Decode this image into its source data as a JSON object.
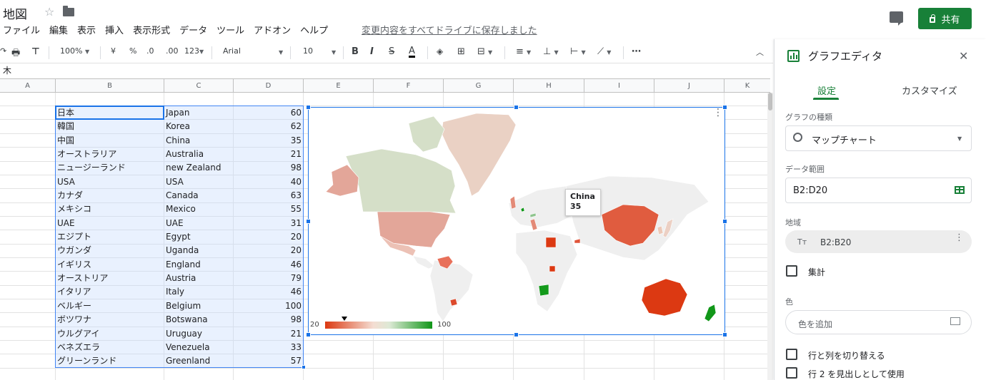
{
  "doc": {
    "title": "地図"
  },
  "menu": [
    "ファイル",
    "編集",
    "表示",
    "挿入",
    "表示形式",
    "データ",
    "ツール",
    "アドオン",
    "ヘルプ"
  ],
  "save_status": "変更内容をすべてドライブに保存しました",
  "share_label": "共有",
  "toolbar": {
    "zoom": "100%",
    "currency": "¥",
    "percent": "%",
    "dec_less": ".0",
    "dec_more": ".00",
    "more_formats": "123",
    "font": "Arial",
    "font_size": "10"
  },
  "formula_value": "木",
  "columns": [
    "A",
    "B",
    "C",
    "D",
    "E",
    "F",
    "G",
    "H",
    "I",
    "J",
    "K"
  ],
  "table": {
    "rows": [
      [
        "日本",
        "Japan",
        "60"
      ],
      [
        "韓国",
        "Korea",
        "62"
      ],
      [
        "中国",
        "China",
        "35"
      ],
      [
        "オーストラリア",
        "Australia",
        "21"
      ],
      [
        "ニュージーランド",
        "new Zealand",
        "98"
      ],
      [
        "USA",
        "USA",
        "40"
      ],
      [
        "カナダ",
        "Canada",
        "63"
      ],
      [
        "メキシコ",
        "Mexico",
        "55"
      ],
      [
        "UAE",
        "UAE",
        "31"
      ],
      [
        "エジプト",
        "Egypt",
        "20"
      ],
      [
        "ウガンダ",
        "Uganda",
        "20"
      ],
      [
        "イギリス",
        "England",
        "46"
      ],
      [
        "オーストリア",
        "Austria",
        "79"
      ],
      [
        "イタリア",
        "Italy",
        "46"
      ],
      [
        "ベルギー",
        "Belgium",
        "100"
      ],
      [
        "ボツワナ",
        "Botswana",
        "98"
      ],
      [
        "ウルグアイ",
        "Uruguay",
        "21"
      ],
      [
        "ベネズエラ",
        "Venezuela",
        "33"
      ],
      [
        "グリーンランド",
        "Greenland",
        "57"
      ]
    ]
  },
  "chart": {
    "tooltip_country": "China",
    "tooltip_value": "35",
    "legend_min": "20",
    "legend_max": "100",
    "low_color": "#dc3912",
    "high_color": "#109618",
    "no_data_color": "#f0f0f0"
  },
  "panel": {
    "title": "グラフエディタ",
    "tab_setup": "設定",
    "tab_customize": "カスタマイズ",
    "chart_type_label": "グラフの種類",
    "chart_type": "マップチャート",
    "range_label": "データ範囲",
    "range": "B2:D20",
    "region_label": "地域",
    "region_value": "B2:B20",
    "aggregate_label": "集計",
    "color_label": "色",
    "add_color": "色を追加",
    "switch_label": "行と列を切り替える",
    "header_label": "行 2 を見出しとして使用"
  }
}
